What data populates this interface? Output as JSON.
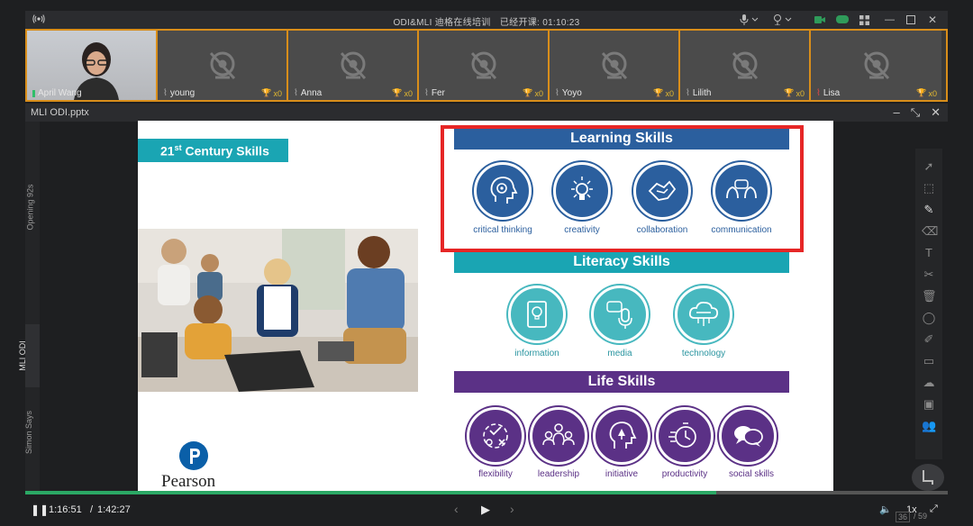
{
  "topbar": {
    "title": "ODI&MLI 迪格在线培训　已经开课: 01:10:23"
  },
  "participants": [
    {
      "name": "April Wang",
      "score": ""
    },
    {
      "name": "young",
      "score": "x0"
    },
    {
      "name": "Anna",
      "score": "x0"
    },
    {
      "name": "Fer",
      "score": "x0"
    },
    {
      "name": "Yoyo",
      "score": "x0"
    },
    {
      "name": "Lilith",
      "score": "x0"
    },
    {
      "name": "Lisa",
      "score": "x0"
    }
  ],
  "document": {
    "filename": "MLI ODI.pptx"
  },
  "rail": {
    "tabs": [
      "Opening 92s",
      "MLI ODI",
      "Simon Says"
    ]
  },
  "slide": {
    "header_main": "21",
    "header_sup": "st",
    "header_rest": " Century Skills",
    "learning": {
      "title": "Learning Skills",
      "items": [
        "critical thinking",
        "creativity",
        "collaboration",
        "communication"
      ]
    },
    "literacy": {
      "title": "Literacy Skills",
      "items": [
        "information",
        "media",
        "technology"
      ]
    },
    "life": {
      "title": "Life Skills",
      "items": [
        "flexibility",
        "leadership",
        "initiative",
        "productivity",
        "social skills"
      ]
    },
    "brand": "Pearson",
    "page_number": "36"
  },
  "colors": {
    "learning": "#2b5f9e",
    "literacy": "#1aa5b3",
    "life": "#5b3186",
    "highlight": "#e62626",
    "frame": "#d98e1a",
    "progress": "#2ba865"
  },
  "player": {
    "current": "1:16:51",
    "separator": "/",
    "duration": "1:42:27",
    "speed": "1x",
    "page_current": "36",
    "page_total": "/ 59",
    "progress_fraction": 0.749
  }
}
